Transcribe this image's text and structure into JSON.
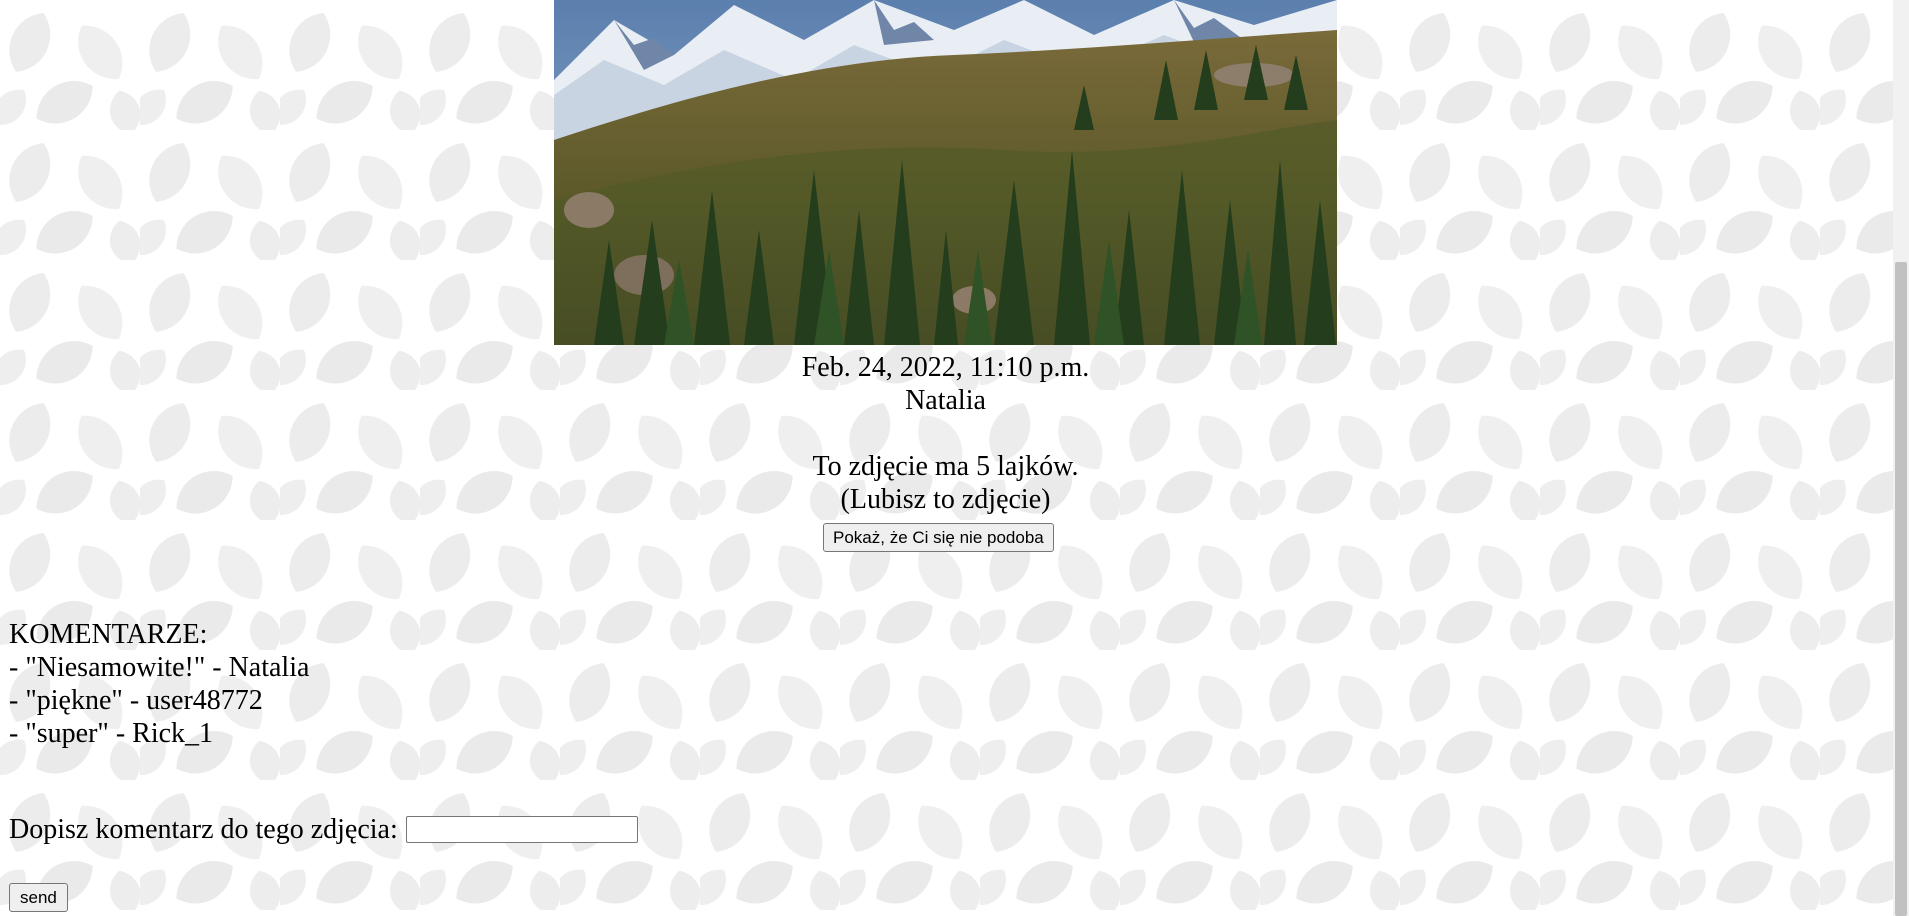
{
  "photo": {
    "alt": "mountain-landscape-photo"
  },
  "post": {
    "date": "Feb. 24, 2022, 11:10 p.m.",
    "author": "Natalia",
    "likes_text": "To zdjęcie ma 5 lajków.",
    "liked_status": "(Lubisz to zdjęcie)",
    "dislike_button": "Pokaż, że Ci się nie podoba"
  },
  "comments": {
    "heading": "KOMENTARZE:",
    "items": [
      "- \"Niesamowite!\" - Natalia",
      "- \"piękne\" - user48772",
      "- \"super\" - Rick_1"
    ]
  },
  "add_comment": {
    "label": "Dopisz komentarz do tego zdjęcia:",
    "value": "",
    "send_button": "send"
  },
  "colors": {
    "background": "#ffffff",
    "pattern": "#ececec",
    "button_bg": "#efefef",
    "button_border": "#767676"
  }
}
